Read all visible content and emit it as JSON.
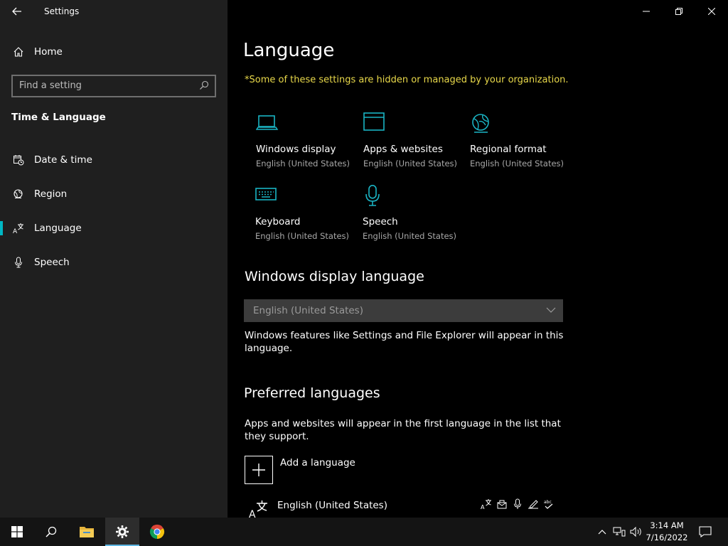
{
  "window": {
    "app_title": "Settings"
  },
  "sidebar": {
    "home_label": "Home",
    "search_placeholder": "Find a setting",
    "section_title": "Time & Language",
    "items": [
      {
        "label": "Date & time",
        "icon": "calendar-clock-icon"
      },
      {
        "label": "Region",
        "icon": "globe-icon"
      },
      {
        "label": "Language",
        "icon": "language-icon",
        "selected": true
      },
      {
        "label": "Speech",
        "icon": "microphone-icon"
      }
    ]
  },
  "main": {
    "title": "Language",
    "org_notice": "*Some of these settings are hidden or managed by your organization.",
    "tiles": [
      {
        "title": "Windows display",
        "subtitle": "English (United States)",
        "icon": "laptop-icon"
      },
      {
        "title": "Apps & websites",
        "subtitle": "English (United States)",
        "icon": "window-icon"
      },
      {
        "title": "Regional format",
        "subtitle": "English (United States)",
        "icon": "globe-icon"
      },
      {
        "title": "Keyboard",
        "subtitle": "English (United States)",
        "icon": "keyboard-icon"
      },
      {
        "title": "Speech",
        "subtitle": "English (United States)",
        "icon": "microphone-icon"
      }
    ],
    "display_language": {
      "heading": "Windows display language",
      "selected": "English (United States)",
      "description": "Windows features like Settings and File Explorer will appear in this language."
    },
    "preferred": {
      "heading": "Preferred languages",
      "description": "Apps and websites will appear in the first language in the list that they support.",
      "add_label": "Add a language",
      "languages": [
        {
          "name": "English (United States)"
        }
      ]
    }
  },
  "taskbar": {
    "time": "3:14 AM",
    "date": "7/16/2022"
  },
  "colors": {
    "accent": "#00b7c3",
    "sidebar_bg": "#1f1f1f",
    "notice": "#e8d84a",
    "taskbar_active": "#5fb8e4"
  }
}
